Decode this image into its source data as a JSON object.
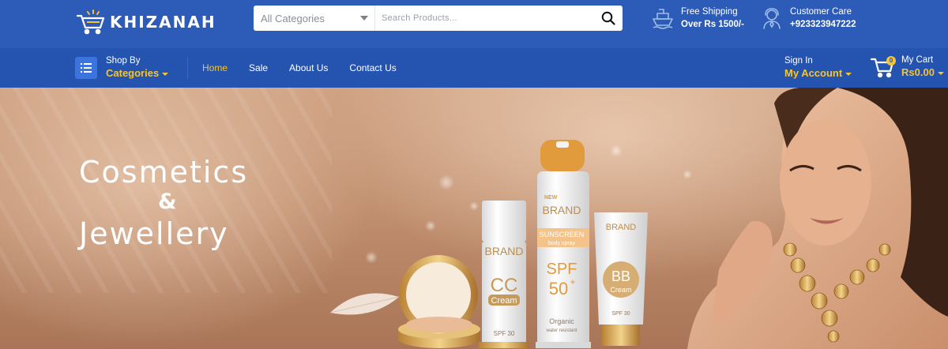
{
  "brand": {
    "name": "KHIZANAH"
  },
  "search": {
    "category_label": "All Categories",
    "placeholder": "Search Products..."
  },
  "shipping": {
    "line1": "Free Shipping",
    "line2": "Over Rs 1500/-"
  },
  "care": {
    "line1": "Customer Care",
    "line2": "+923323947222"
  },
  "nav": {
    "shop_by": "Shop By",
    "categories": "Categories",
    "links": [
      "Home",
      "Sale",
      "About Us",
      "Contact Us"
    ],
    "active_index": 0
  },
  "account": {
    "sign_in": "Sign In",
    "my_account": "My Account"
  },
  "cart": {
    "label": "My Cart",
    "total": "Rs0.00",
    "count": "0"
  },
  "hero": {
    "line1": "Cosmetics",
    "amp": "&",
    "line2": "Jewellery",
    "products": {
      "brand": "BRAND",
      "new_tag": "NEW",
      "spray_sub1": "SUNSCREEN",
      "spray_sub2": "body spray",
      "spray_spf": "SPF",
      "spray_num": "50",
      "spray_plus": "+",
      "spray_foot1": "Organic",
      "spray_foot2": "water resistant",
      "cc_big": "CC",
      "cc_word": "Cream",
      "cc_spf": "SPF 30",
      "bb_big": "BB",
      "bb_word": "Cream",
      "bb_spf": "SPF 30"
    }
  },
  "colors": {
    "topbar": "#2d5bb8",
    "navbar": "#2554b0",
    "accent_yellow": "#f6c431"
  }
}
